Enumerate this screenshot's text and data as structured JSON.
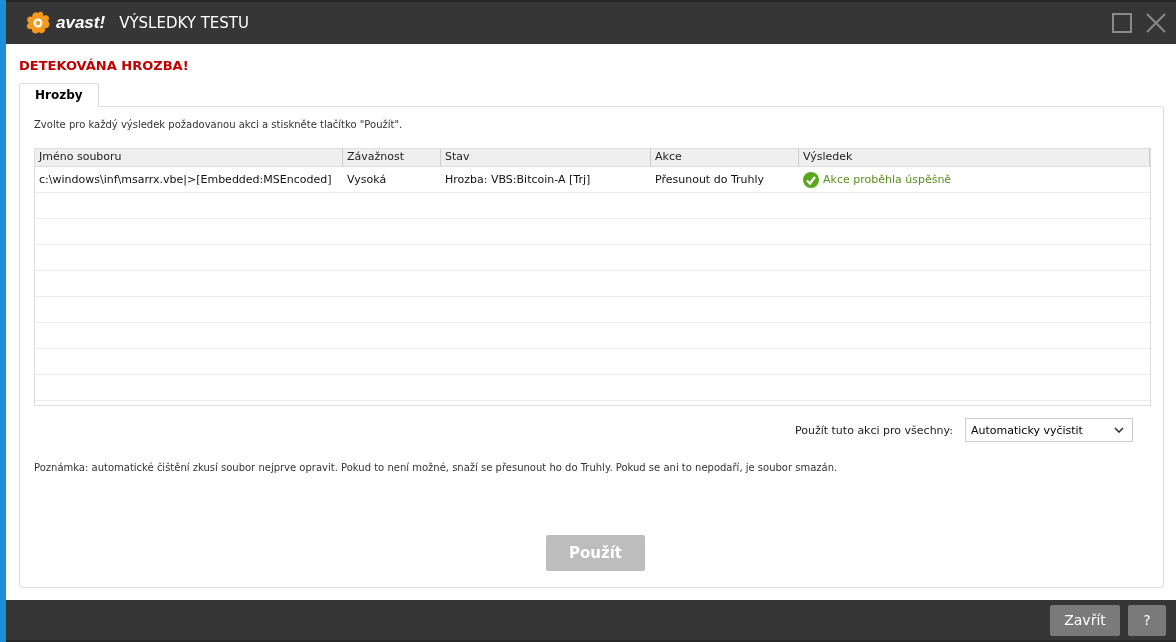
{
  "window": {
    "logo_text": "avast!",
    "title": "VÝSLEDKY TESTU"
  },
  "heading": "DETEKOVÁNA HROZBA!",
  "tabs": [
    {
      "label": "Hrozby",
      "selected": true
    }
  ],
  "instruction": "Zvolte pro každý výsledek požadovanou akci a stiskněte tlačítko \"Použít\".",
  "table": {
    "columns": [
      "Jméno souboru",
      "Závažnost",
      "Stav",
      "Akce",
      "Výsledek"
    ],
    "rows": [
      {
        "file": "c:\\windows\\inf\\msarrx.vbe|>[Embedded:MSEncoded]",
        "severity": "Vysoká",
        "status": "Hrozba: VBS:Bitcoin-A [Trj]",
        "action": "Přesunout do Truhly",
        "result": {
          "kind": "success",
          "text": "Akce proběhla úspěšně"
        }
      }
    ]
  },
  "apply_all": {
    "label": "Použít tuto akci pro všechny:",
    "value": "Automaticky vyčistit"
  },
  "note": "Poznámka: automatické čištění zkusí soubor nejprve opravit. Pokud to není možné, snaží se přesunout ho do Truhly. Pokud se ani to nepodaří, je soubor smazán.",
  "apply_button": {
    "label": "Použít",
    "disabled": true
  },
  "footer_buttons": [
    "Zavřít",
    "?"
  ]
}
